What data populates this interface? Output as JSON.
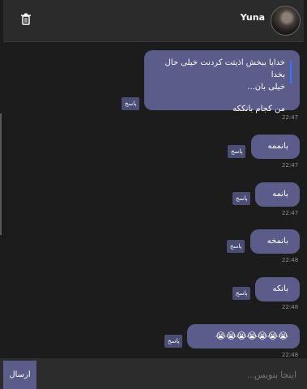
{
  "header": {
    "username": "Yuna",
    "trash_icon": "trash-icon"
  },
  "messages": [
    {
      "line1": "خدایا ببخش اذیتت کردنت خیلی حال بخدا",
      "line2": "خیلی بان...",
      "line3": "من کجام بانککه",
      "reply": "پاسخ",
      "time": "22:47"
    },
    {
      "text": "بانممه",
      "reply": "پاسخ",
      "time": "22:47"
    },
    {
      "text": "بانمه",
      "reply": "پاسخ",
      "time": "22:47"
    },
    {
      "text": "بانمخه",
      "reply": "پاسخ",
      "time": "22:48"
    },
    {
      "text": "بانکه",
      "reply": "پاسخ",
      "time": "22:48"
    },
    {
      "text": "😭😭😭😭😭😭😭",
      "reply": "پاسخ",
      "time": "22:48"
    }
  ],
  "composer": {
    "placeholder": "اینجا بنویس...",
    "send_label": "ارسال"
  }
}
